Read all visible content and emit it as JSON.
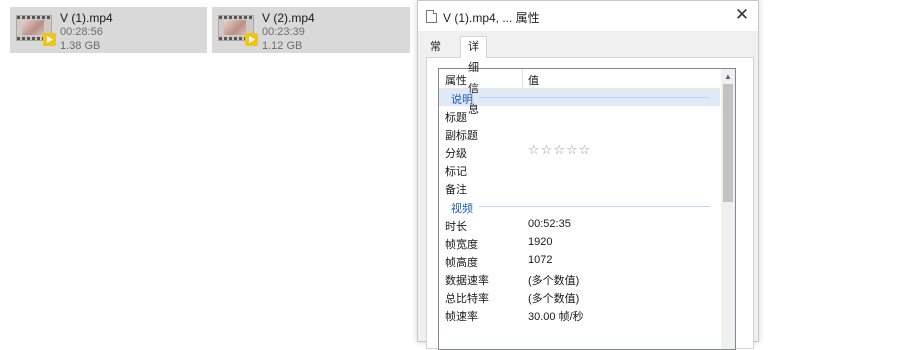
{
  "files": [
    {
      "name": "V (1).mp4",
      "duration": "00:28:56",
      "size": "1.38 GB"
    },
    {
      "name": "V (2).mp4",
      "duration": "00:23:39",
      "size": "1.12 GB"
    }
  ],
  "dialog": {
    "title": "V (1).mp4, ... 属性",
    "close_glyph": "✕",
    "tabs": {
      "general": "常规",
      "details": "详细信息"
    },
    "columns": {
      "property": "属性",
      "value": "值"
    },
    "groups": {
      "description": "说明",
      "video": "视频"
    },
    "description_rows": [
      {
        "key": "标题",
        "value": ""
      },
      {
        "key": "副标题",
        "value": ""
      },
      {
        "key": "分级",
        "value": "☆☆☆☆☆",
        "rating": 0
      },
      {
        "key": "标记",
        "value": ""
      },
      {
        "key": "备注",
        "value": ""
      }
    ],
    "video_rows": [
      {
        "key": "时长",
        "value": "00:52:35"
      },
      {
        "key": "帧宽度",
        "value": "1920"
      },
      {
        "key": "帧高度",
        "value": "1072"
      },
      {
        "key": "数据速率",
        "value": "(多个数值)"
      },
      {
        "key": "总比特率",
        "value": "(多个数值)"
      },
      {
        "key": "帧速率",
        "value": "30.00 帧/秒"
      }
    ]
  },
  "colors": {
    "accent": "#1e5aa8",
    "tile_bg": "#d9d9d9",
    "selection": "#dfe9f7"
  }
}
